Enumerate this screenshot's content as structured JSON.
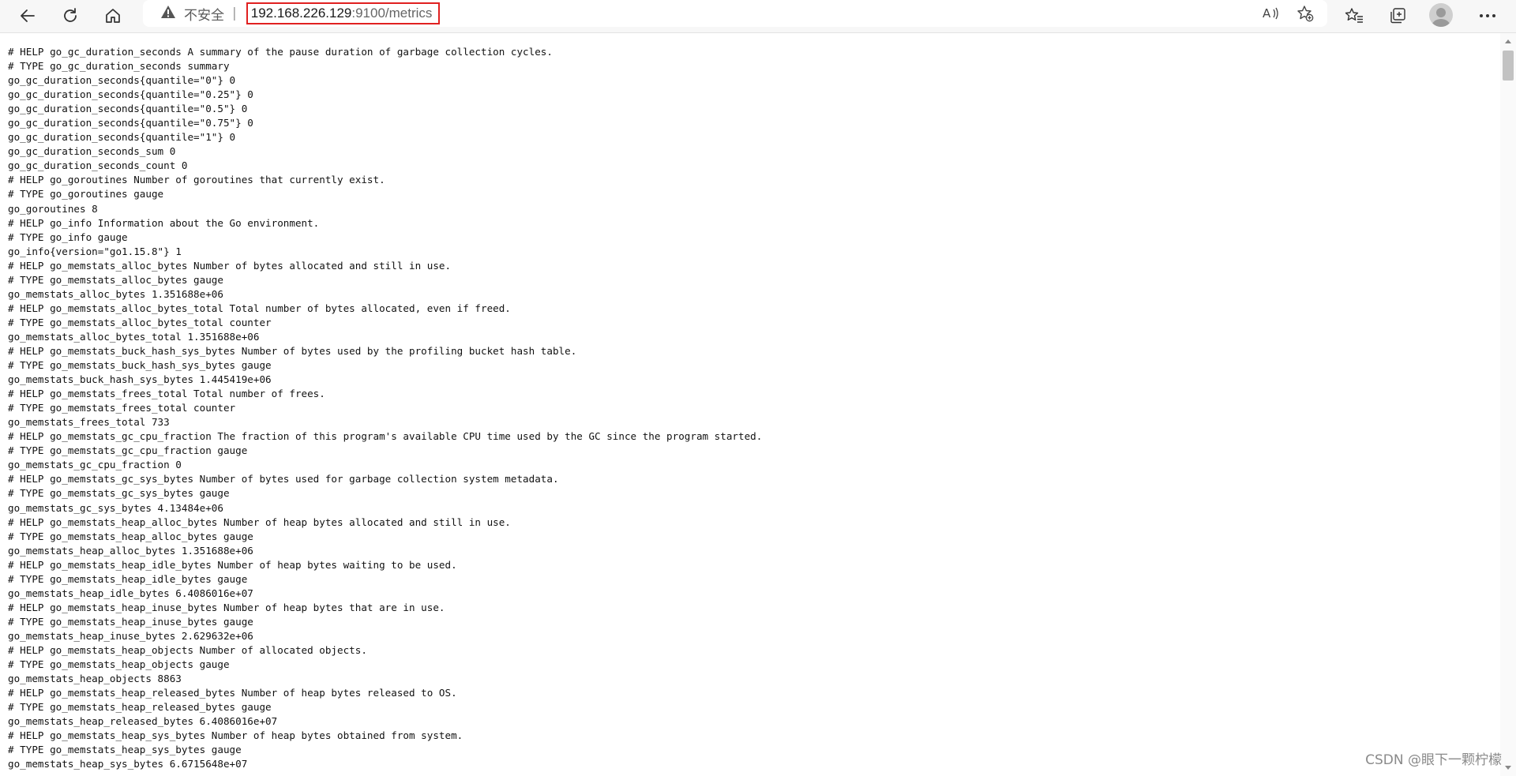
{
  "browser": {
    "security_label": "不安全",
    "url_host": "192.168.226.129",
    "url_path": ":9100/metrics",
    "icons": {
      "back": "back-arrow-icon",
      "refresh": "refresh-icon",
      "home": "home-icon",
      "warning": "warning-icon",
      "read_aloud": "read-aloud-icon",
      "favorite_add": "add-favorite-icon",
      "favorites": "favorites-icon",
      "collections": "collections-icon",
      "profile": "profile-avatar-icon",
      "more": "more-icon"
    }
  },
  "metrics_lines": [
    "# HELP go_gc_duration_seconds A summary of the pause duration of garbage collection cycles.",
    "# TYPE go_gc_duration_seconds summary",
    "go_gc_duration_seconds{quantile=\"0\"} 0",
    "go_gc_duration_seconds{quantile=\"0.25\"} 0",
    "go_gc_duration_seconds{quantile=\"0.5\"} 0",
    "go_gc_duration_seconds{quantile=\"0.75\"} 0",
    "go_gc_duration_seconds{quantile=\"1\"} 0",
    "go_gc_duration_seconds_sum 0",
    "go_gc_duration_seconds_count 0",
    "# HELP go_goroutines Number of goroutines that currently exist.",
    "# TYPE go_goroutines gauge",
    "go_goroutines 8",
    "# HELP go_info Information about the Go environment.",
    "# TYPE go_info gauge",
    "go_info{version=\"go1.15.8\"} 1",
    "# HELP go_memstats_alloc_bytes Number of bytes allocated and still in use.",
    "# TYPE go_memstats_alloc_bytes gauge",
    "go_memstats_alloc_bytes 1.351688e+06",
    "# HELP go_memstats_alloc_bytes_total Total number of bytes allocated, even if freed.",
    "# TYPE go_memstats_alloc_bytes_total counter",
    "go_memstats_alloc_bytes_total 1.351688e+06",
    "# HELP go_memstats_buck_hash_sys_bytes Number of bytes used by the profiling bucket hash table.",
    "# TYPE go_memstats_buck_hash_sys_bytes gauge",
    "go_memstats_buck_hash_sys_bytes 1.445419e+06",
    "# HELP go_memstats_frees_total Total number of frees.",
    "# TYPE go_memstats_frees_total counter",
    "go_memstats_frees_total 733",
    "# HELP go_memstats_gc_cpu_fraction The fraction of this program's available CPU time used by the GC since the program started.",
    "# TYPE go_memstats_gc_cpu_fraction gauge",
    "go_memstats_gc_cpu_fraction 0",
    "# HELP go_memstats_gc_sys_bytes Number of bytes used for garbage collection system metadata.",
    "# TYPE go_memstats_gc_sys_bytes gauge",
    "go_memstats_gc_sys_bytes 4.13484e+06",
    "# HELP go_memstats_heap_alloc_bytes Number of heap bytes allocated and still in use.",
    "# TYPE go_memstats_heap_alloc_bytes gauge",
    "go_memstats_heap_alloc_bytes 1.351688e+06",
    "# HELP go_memstats_heap_idle_bytes Number of heap bytes waiting to be used.",
    "# TYPE go_memstats_heap_idle_bytes gauge",
    "go_memstats_heap_idle_bytes 6.4086016e+07",
    "# HELP go_memstats_heap_inuse_bytes Number of heap bytes that are in use.",
    "# TYPE go_memstats_heap_inuse_bytes gauge",
    "go_memstats_heap_inuse_bytes 2.629632e+06",
    "# HELP go_memstats_heap_objects Number of allocated objects.",
    "# TYPE go_memstats_heap_objects gauge",
    "go_memstats_heap_objects 8863",
    "# HELP go_memstats_heap_released_bytes Number of heap bytes released to OS.",
    "# TYPE go_memstats_heap_released_bytes gauge",
    "go_memstats_heap_released_bytes 6.4086016e+07",
    "# HELP go_memstats_heap_sys_bytes Number of heap bytes obtained from system.",
    "# TYPE go_memstats_heap_sys_bytes gauge",
    "go_memstats_heap_sys_bytes 6.6715648e+07"
  ],
  "watermark": "CSDN @眼下一颗柠檬"
}
